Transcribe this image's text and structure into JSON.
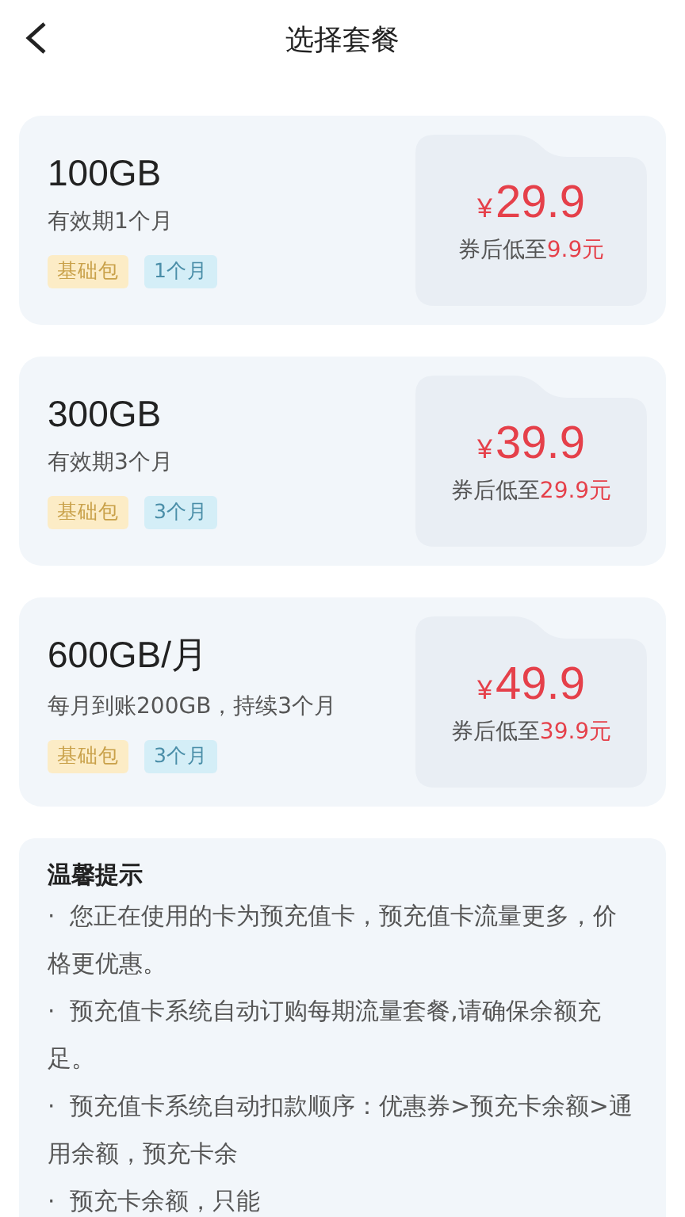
{
  "header": {
    "title": "选择套餐"
  },
  "plans": [
    {
      "name": "100GB",
      "validity": "有效期1个月",
      "tags": [
        {
          "kind": "base",
          "label": "基础包"
        },
        {
          "kind": "duration",
          "label": "1个月"
        }
      ],
      "currency": "¥",
      "price": "29.9",
      "coupon_label": "券后低至",
      "coupon_price": "9.9元"
    },
    {
      "name": "300GB",
      "validity": "有效期3个月",
      "tags": [
        {
          "kind": "base",
          "label": "基础包"
        },
        {
          "kind": "duration",
          "label": "3个月"
        }
      ],
      "currency": "¥",
      "price": "39.9",
      "coupon_label": "券后低至",
      "coupon_price": "29.9元"
    },
    {
      "name": "600GB/月",
      "validity": "每月到账200GB，持续3个月",
      "tags": [
        {
          "kind": "base",
          "label": "基础包"
        },
        {
          "kind": "duration",
          "label": "3个月"
        }
      ],
      "currency": "¥",
      "price": "49.9",
      "coupon_label": "券后低至",
      "coupon_price": "39.9元"
    }
  ],
  "notes": {
    "title": "温馨提示",
    "items": [
      "·  您正在使用的卡为预充值卡，预充值卡流量更多，价格更优惠。",
      "·  预充值卡系统自动订购每期流量套餐,请确保余额充足。",
      "·  预充值卡系统自动扣款顺序：优惠券>预充卡余额>通用余额，预充卡余",
      "·  预充卡余额，只能"
    ]
  }
}
